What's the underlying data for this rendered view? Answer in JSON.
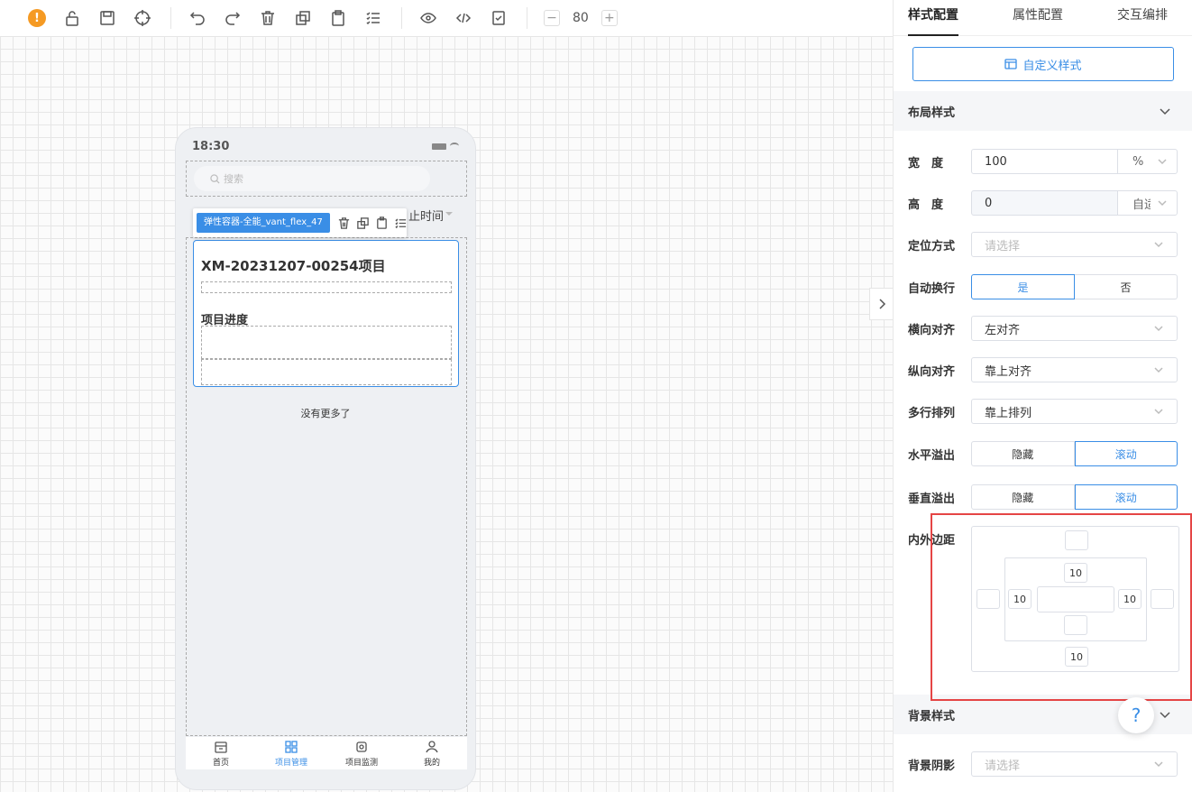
{
  "toolbar": {
    "warn_glyph": "!",
    "zoom_minus": "−",
    "zoom_value": "80",
    "zoom_plus": "+",
    "icons": [
      "warning-icon",
      "unlock-icon",
      "save-icon",
      "target-icon",
      "undo-icon",
      "redo-icon",
      "delete-icon",
      "copy-icon",
      "paste-icon",
      "list-icon",
      "preview-icon",
      "code-icon",
      "check-doc-icon"
    ]
  },
  "phone": {
    "time": "18:30",
    "search_placeholder": "搜索",
    "filter_text": "止时间",
    "selected_tag": "弹性容器-全能_vant_flex_47",
    "card_title": "XM-20231207-00254项目",
    "card_label": "项目进度",
    "no_more": "没有更多了",
    "tabs": [
      {
        "label": "首页",
        "icon": "home-icon",
        "active": false
      },
      {
        "label": "项目管理",
        "icon": "grid-icon",
        "active": true
      },
      {
        "label": "项目监测",
        "icon": "monitor-icon",
        "active": false
      },
      {
        "label": "我的",
        "icon": "user-icon",
        "active": false
      }
    ]
  },
  "panel": {
    "tabs": [
      "样式配置",
      "属性配置",
      "交互编排"
    ],
    "custom_style_btn": "自定义样式",
    "layout_section": "布局样式",
    "width": {
      "label": "宽　度",
      "value": "100",
      "unit": "%"
    },
    "height": {
      "label": "高　度",
      "value": "0",
      "unit": "自适"
    },
    "position": {
      "label": "定位方式",
      "placeholder": "请选择"
    },
    "wrap": {
      "label": "自动换行",
      "yes": "是",
      "no": "否"
    },
    "h_align": {
      "label": "横向对齐",
      "value": "左对齐"
    },
    "v_align": {
      "label": "纵向对齐",
      "value": "靠上对齐"
    },
    "multi_line": {
      "label": "多行排列",
      "value": "靠上排列"
    },
    "h_overflow": {
      "label": "水平溢出",
      "hide": "隐藏",
      "scroll": "滚动"
    },
    "v_overflow": {
      "label": "垂直溢出",
      "hide": "隐藏",
      "scroll": "滚动"
    },
    "spacing": {
      "label": "内外边距",
      "padding_top": "10",
      "padding_left": "10",
      "padding_right": "10",
      "padding_bottom": "10"
    },
    "bg_section": "背景样式",
    "bg_shadow": {
      "label": "背景阴影",
      "placeholder": "请选择"
    },
    "help": "?"
  },
  "colors": {
    "accent": "#3a8ee6",
    "highlight": "#e54545",
    "warning": "#f59a23"
  }
}
